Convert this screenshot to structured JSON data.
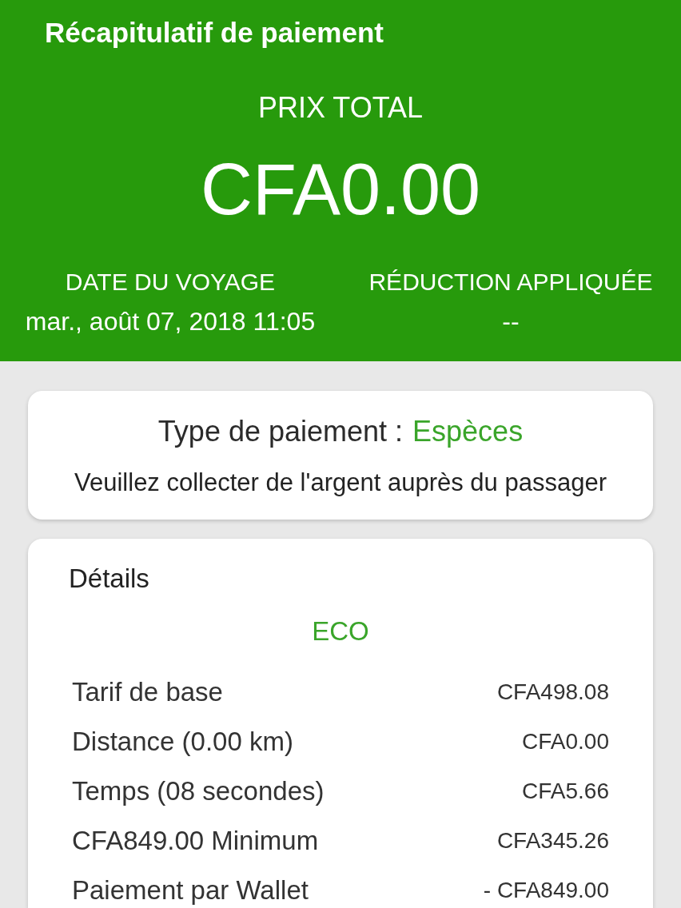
{
  "header": {
    "title": "Récapitulatif de paiement",
    "total_label": "PRIX TOTAL",
    "total_amount": "CFA0.00",
    "info": [
      {
        "label": "DATE DU VOYAGE",
        "value": "mar., août 07, 2018 11:05"
      },
      {
        "label": "RÉDUCTION APPLIQUÉE",
        "value": "--"
      }
    ]
  },
  "payment_card": {
    "type_label": "Type de paiement :",
    "type_value": "Espèces",
    "note": "Veuillez collecter de l'argent auprès du passager"
  },
  "details_card": {
    "title": "Détails",
    "category": "ECO",
    "rows": [
      {
        "label": "Tarif de base",
        "amount": "CFA498.08"
      },
      {
        "label": "Distance (0.00 km)",
        "amount": "CFA0.00"
      },
      {
        "label": "Temps (08 secondes)",
        "amount": "CFA5.66"
      },
      {
        "label": "CFA849.00 Minimum",
        "amount": "CFA345.26"
      },
      {
        "label": "Paiement par Wallet",
        "amount": "- CFA849.00"
      }
    ]
  }
}
